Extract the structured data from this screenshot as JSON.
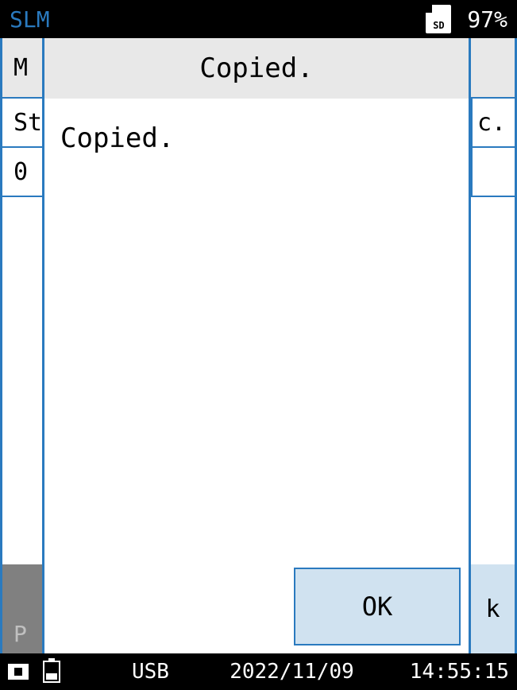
{
  "topbar": {
    "title": "SLM",
    "sd_label": "SD",
    "battery": "97%"
  },
  "background": {
    "row1_left": "M",
    "row2_left": "St",
    "row2_right": "c.",
    "row3_left": "0",
    "bottom_left": "P",
    "bottom_right": "k"
  },
  "dialog": {
    "title": "Copied.",
    "message": "Copied.",
    "ok_label": "OK"
  },
  "statusbar": {
    "usb": "USB",
    "date": "2022/11/09",
    "time": "14:55:15"
  }
}
